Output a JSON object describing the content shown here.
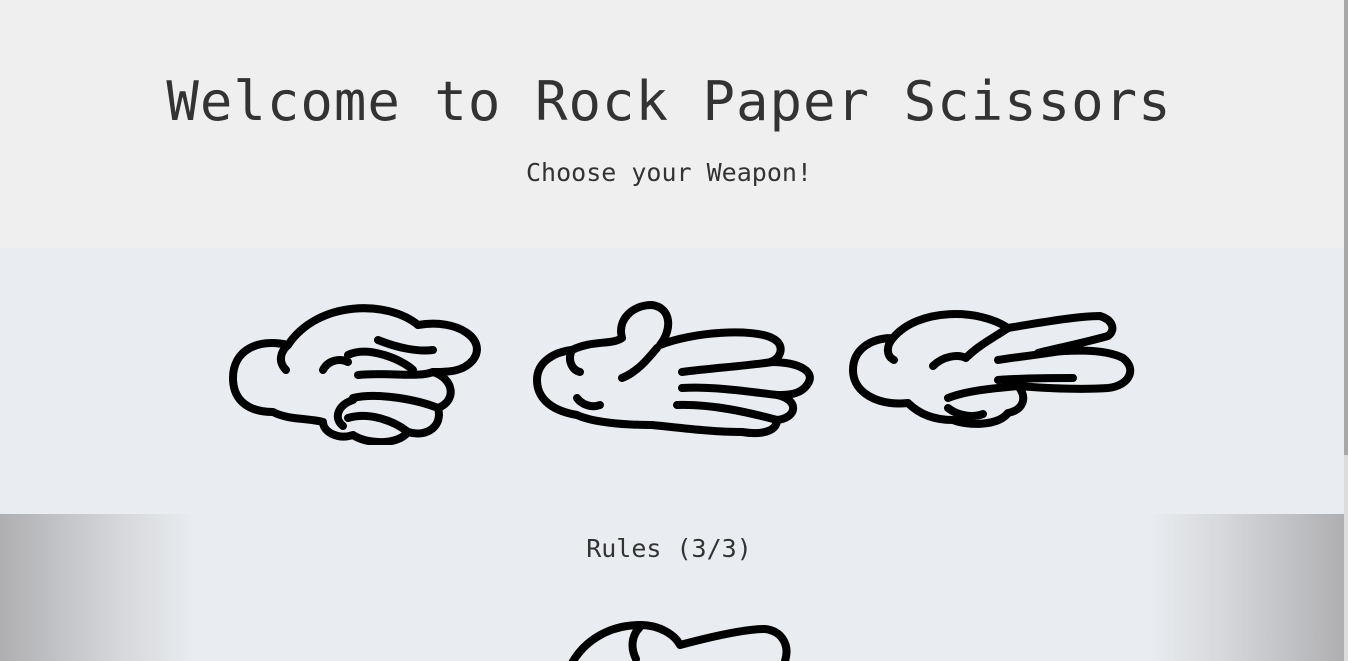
{
  "header": {
    "title": "Welcome to Rock Paper Scissors",
    "subtitle": "Choose your Weapon!"
  },
  "weapons": [
    {
      "name": "rock",
      "icon": "rock-hand-icon"
    },
    {
      "name": "paper",
      "icon": "paper-hand-icon"
    },
    {
      "name": "scissors",
      "icon": "scissors-hand-icon"
    }
  ],
  "rules": {
    "title": "Rules (3/3)",
    "preview_icon": "scissors-hand-icon"
  },
  "colors": {
    "header_bg": "#efefef",
    "section_bg": "#e9ecf0",
    "text": "#333333",
    "stroke": "#000000"
  }
}
